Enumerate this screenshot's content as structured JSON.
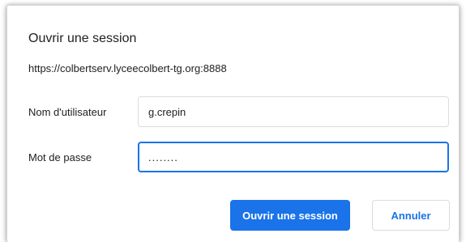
{
  "dialog": {
    "title": "Ouvrir une session",
    "origin": "https://colbertserv.lyceecolbert-tg.org:8888"
  },
  "form": {
    "username_label": "Nom d'utilisateur",
    "username_value": "g.crepin",
    "password_label": "Mot de passe",
    "password_value": "........"
  },
  "buttons": {
    "sign_in_label": "Ouvrir une session",
    "cancel_label": "Annuler"
  },
  "colors": {
    "accent": "#1a73e8",
    "text": "#202124",
    "border": "#dadce0"
  }
}
